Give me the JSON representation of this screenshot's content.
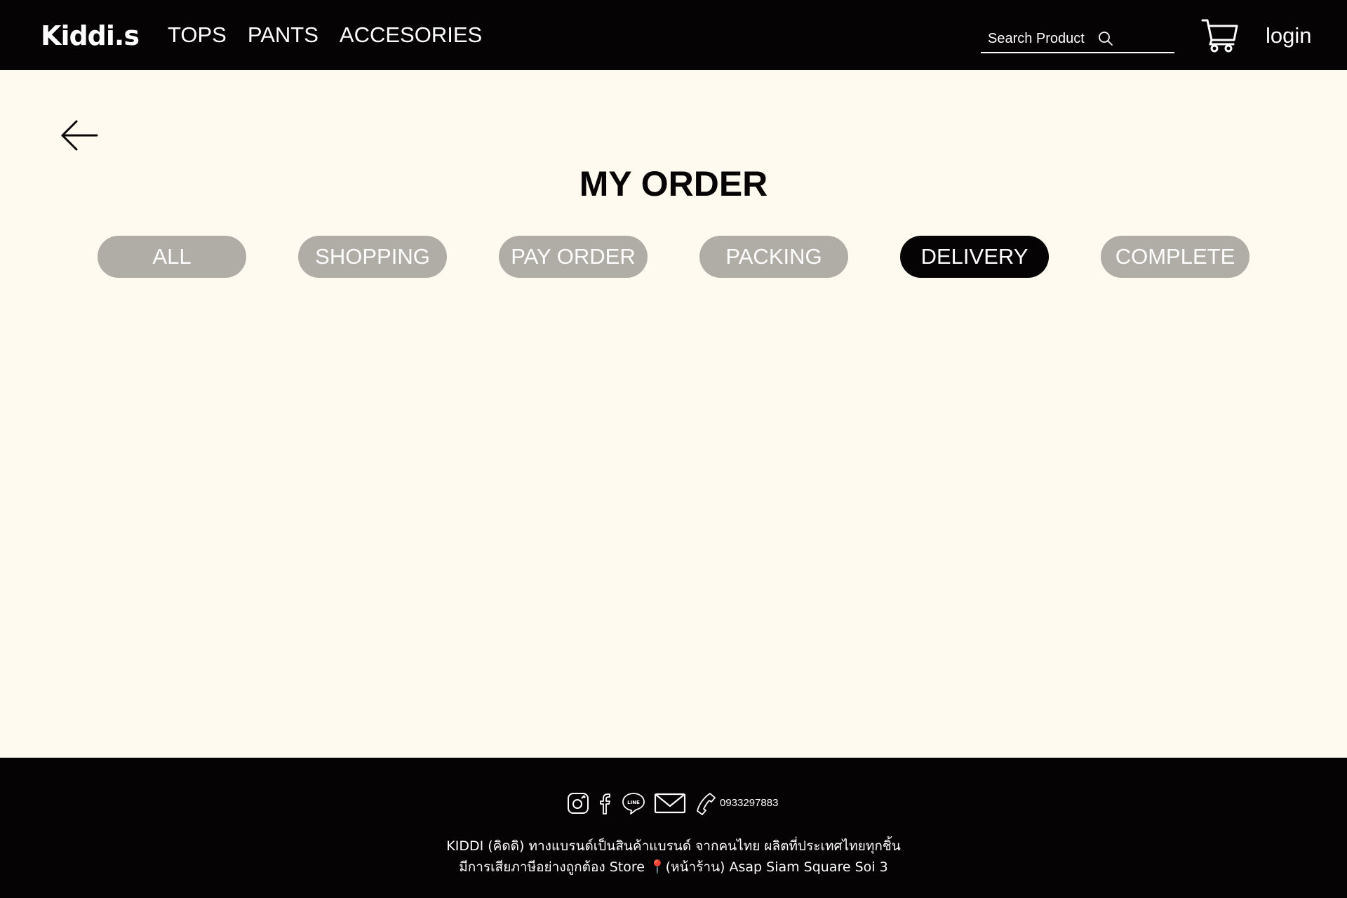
{
  "header": {
    "logo": "Kiddi.s",
    "nav": [
      "TOPS",
      "PANTS",
      "ACCESORIES"
    ],
    "search": {
      "placeholder": "Search Product",
      "icon": "search-icon"
    },
    "cart_icon": "cart-icon",
    "login_label": "login"
  },
  "main": {
    "back_icon": "arrow-left-icon",
    "title": "MY ORDER",
    "tabs": [
      {
        "label": "ALL",
        "active": false
      },
      {
        "label": "SHOPPING",
        "active": false
      },
      {
        "label": "PAY ORDER",
        "active": false
      },
      {
        "label": "PACKING",
        "active": false
      },
      {
        "label": "DELIVERY",
        "active": true
      },
      {
        "label": "COMPLETE",
        "active": false
      }
    ],
    "colors": {
      "tab_inactive": "#b0aca6",
      "tab_active": "#050304",
      "background": "#fefaef"
    }
  },
  "footer": {
    "icons": [
      "instagram-icon",
      "facebook-icon",
      "line-icon",
      "mail-icon",
      "phone-icon"
    ],
    "line_icon_text": "LINE",
    "phone": "0933297883",
    "line1": "KIDDI (คิดดิ) ทางแบรนด์เป็นสินค้าแบรนด์ จากคนไทย ผลิตที่ประเทศไทยทุกชิ้น",
    "line2": "มีการเสียภาษีอย่างถูกต้อง Store 📍(หน้าร้าน) Asap Siam Square Soi 3"
  }
}
